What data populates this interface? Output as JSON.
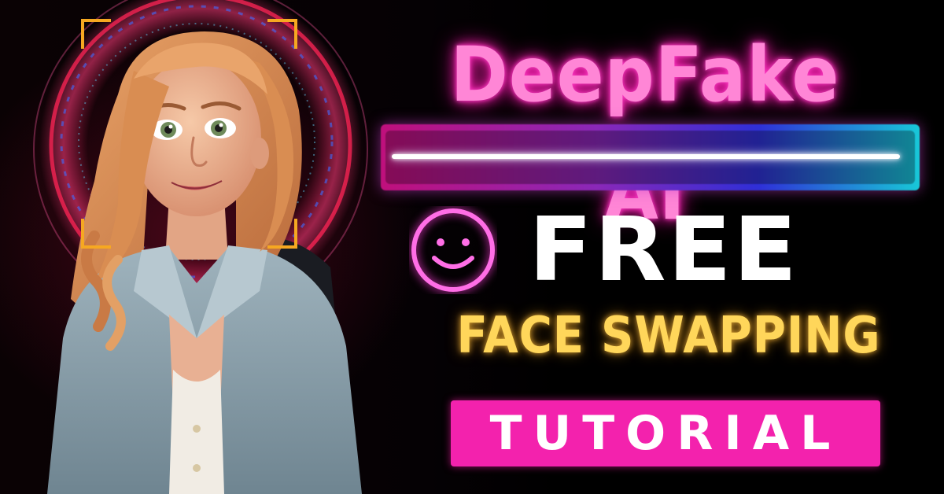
{
  "headline": "DeepFake AI",
  "free_label": "FREE",
  "subtitle": "FACE SWAPPING",
  "badge_label": "TUTORIAL",
  "icons": {
    "emoji": "smile-icon",
    "frame": "focus-frame-bracket"
  },
  "colors": {
    "headline": "#ff86d6",
    "free": "#ffffff",
    "subtitle": "#ffd65a",
    "badge_background": "#f322ad",
    "badge_text": "#ffffff",
    "frame_bracket": "#f6a821",
    "smile_stroke": "#ff6ee6"
  }
}
